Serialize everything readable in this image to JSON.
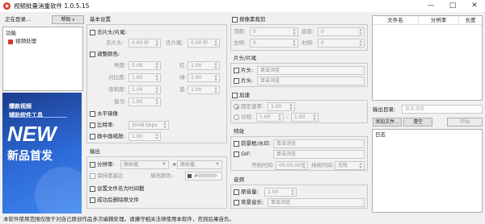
{
  "window": {
    "title": "视频批量消重软件 1.0.5.15",
    "app_icon_glyph": "◉",
    "controls": [
      "—",
      "□",
      "✕"
    ]
  },
  "left": {
    "login_label": "正在登录...",
    "help_label": "帮助",
    "tree_root": "功能",
    "tree_item": "视频处理",
    "banner": {
      "line1": "爆款视频",
      "line2": "辅助软件工具",
      "big": "NEW",
      "bottom": "新品首发"
    }
  },
  "basic": {
    "title": "基本设置",
    "head_tail_label": "去片头/片尾:",
    "go_head_label": "去片头:",
    "go_head_value": "0.00 秒",
    "go_tail_label": "去片尾:",
    "go_tail_value": "0.00 秒",
    "color_label": "调整颜色:",
    "brightness_label": "亮度:",
    "brightness_value": "0.00",
    "red_label": "红:",
    "red_value": "1.00",
    "contrast_label": "对比度:",
    "contrast_value": "1.00",
    "green_label": "绿:",
    "green_value": "1.00",
    "saturation_label": "饱和度:",
    "saturation_value": "1.00",
    "blue_label": "蓝:",
    "blue_value": "1.00",
    "gamma_label": "伽马:",
    "gamma_value": "1.00",
    "mirror_label": "水平镜像",
    "bitrate_label": "比特率:",
    "bitrate_value": "2048 kbps",
    "pip_label": "画中画缩放:",
    "pip_value": "1.00"
  },
  "output": {
    "title": "输出",
    "resolution_label": "分辨率:",
    "res_w": "原始值",
    "res_h": "原始值",
    "keep_ratio_label": "保持宽高比",
    "fill_color_label": "填充颜色:",
    "fill_color_value": "#000000",
    "timestamp_label": "设置文件名为时间戳",
    "delete_label": "成功后删除原文件"
  },
  "random_crop": {
    "title": "按像素裁剪",
    "top_label": "顶部:",
    "top_value": "0",
    "bottom_label": "底部:",
    "bottom_value": "0",
    "left_label": "左侧:",
    "left_value": "0",
    "right_label": "右侧:",
    "right_value": "0"
  },
  "head_tail": {
    "title": "片头/片尾",
    "head_label": "片头:",
    "tail_label": "片尾:",
    "browse": "单击浏览"
  },
  "speed": {
    "label": "加速",
    "fixed_label": "固定速率:",
    "fixed_value": "1.00",
    "segment_label": "分段:",
    "seg_from": "1.00",
    "seg_to": "1.00"
  },
  "effects": {
    "title": "特效",
    "watermark_label": "前景框/水印:",
    "gif_label": "GIF:",
    "browse": "单击浏览",
    "start_label": "开始时间:",
    "start_value": "00:00.000",
    "duration_label": "持续时间:",
    "duration_value": "无限"
  },
  "audio": {
    "title": "音频",
    "volume_label": "原音量:",
    "volume_value": "1.00",
    "bgm_label": "背景音乐:",
    "browse": "单击浏览"
  },
  "files": {
    "columns": [
      "文件名",
      "分辨率",
      "长度"
    ],
    "output_dir_label": "输出目录:",
    "output_dir_placeholder": "单击浏览",
    "add_file_label": "添加文件...",
    "clear_label": "清空",
    "start_label": "开始",
    "log_label": "日志"
  },
  "status": {
    "text": "本软件使用范围仅限于对自己原创作品多次编辑处理。请遵守相关法律使用本软件，否则后果自负。"
  }
}
